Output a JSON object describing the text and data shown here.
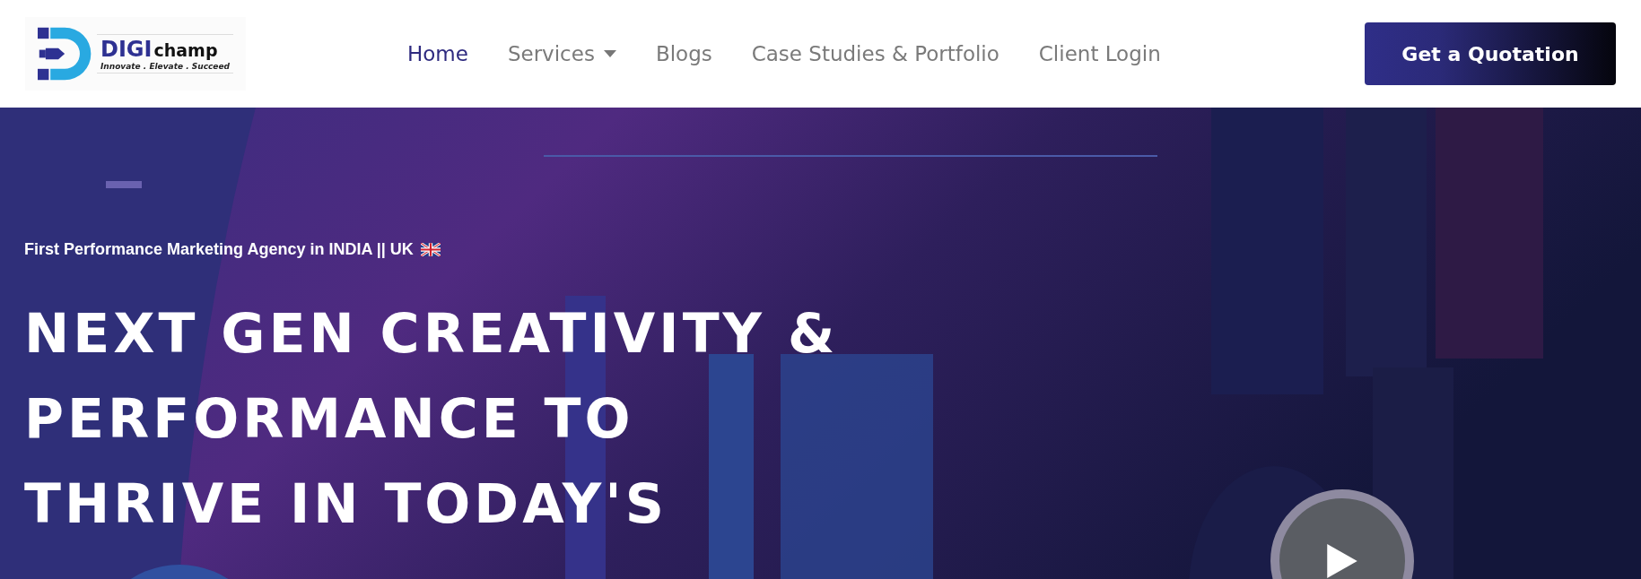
{
  "header": {
    "logo": {
      "brand_first": "DIGI",
      "brand_second": "champ",
      "tagline": "Innovate . Elevate . Succeed"
    },
    "nav": [
      {
        "label": "Home",
        "selected": true,
        "has_dropdown": false
      },
      {
        "label": "Services",
        "selected": false,
        "has_dropdown": true
      },
      {
        "label": "Blogs",
        "selected": false,
        "has_dropdown": false
      },
      {
        "label": "Case Studies & Portfolio",
        "selected": false,
        "has_dropdown": false
      },
      {
        "label": "Client Login",
        "selected": false,
        "has_dropdown": false
      }
    ],
    "cta_button": "Get a Quotation"
  },
  "hero": {
    "tagline": "First Performance Marketing Agency in INDIA || UK",
    "has_flag": true,
    "heading_lines": [
      "NEXT GEN CREATIVITY &",
      "PERFORMANCE TO",
      "THRIVE IN TODAY'S"
    ],
    "play_button": {
      "kind": "video"
    }
  }
}
